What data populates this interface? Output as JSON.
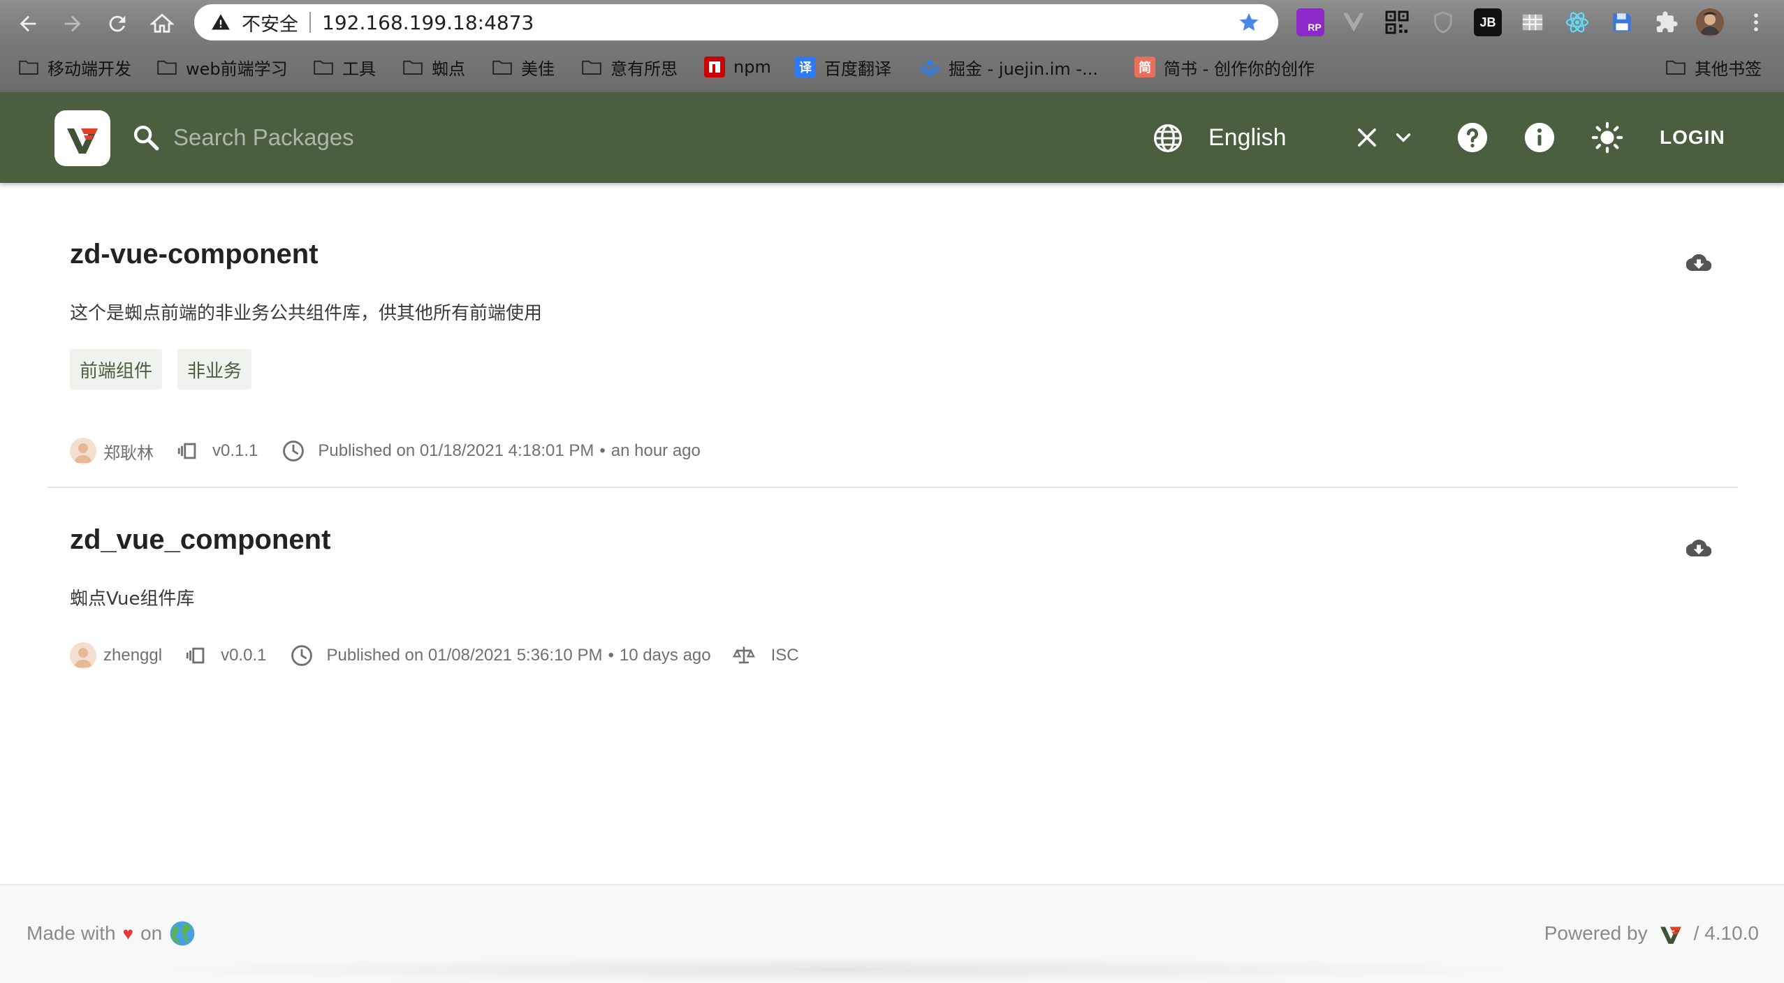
{
  "browser": {
    "insecure_label": "不安全",
    "url": "192.168.199.18:4873",
    "bookmarks": [
      {
        "label": "移动端开发",
        "type": "folder"
      },
      {
        "label": "web前端学习",
        "type": "folder"
      },
      {
        "label": "工具",
        "type": "folder"
      },
      {
        "label": "蜘点",
        "type": "folder"
      },
      {
        "label": "美佳",
        "type": "folder"
      },
      {
        "label": "意有所思",
        "type": "folder"
      },
      {
        "label": "npm",
        "type": "npm-icon"
      },
      {
        "label": "百度翻译",
        "type": "translate-icon"
      },
      {
        "label": "掘金 - juejin.im -...",
        "type": "juejin-icon"
      },
      {
        "label": "简书 - 创作你的创作",
        "type": "jianshu-icon"
      },
      {
        "label": "其他书签",
        "type": "folder"
      }
    ],
    "extensions": {
      "rp": "RP",
      "jb": "JB"
    }
  },
  "header": {
    "search_placeholder": "Search Packages",
    "language": "English",
    "login_label": "LOGIN",
    "brand_color": "#4b5e40"
  },
  "packages": [
    {
      "name": "zd-vue-component",
      "description": "这个是蜘点前端的非业务公共组件库，供其他所有前端使用",
      "tags": [
        "前端组件",
        "非业务"
      ],
      "author": "郑耿林",
      "version": "v0.1.1",
      "published": "Published on 01/18/2021 4:18:01 PM",
      "relative_time": "an hour ago",
      "license": ""
    },
    {
      "name": "zd_vue_component",
      "description": "蜘点Vue组件库",
      "tags": [],
      "author": "zhenggl",
      "version": "v0.0.1",
      "published": "Published on 01/08/2021 5:36:10 PM",
      "relative_time": "10 days ago",
      "license": "ISC"
    }
  ],
  "footer": {
    "made_with": "Made with",
    "heart": "♥",
    "on": "on",
    "powered_by": "Powered by",
    "version": "/ 4.10.0"
  }
}
